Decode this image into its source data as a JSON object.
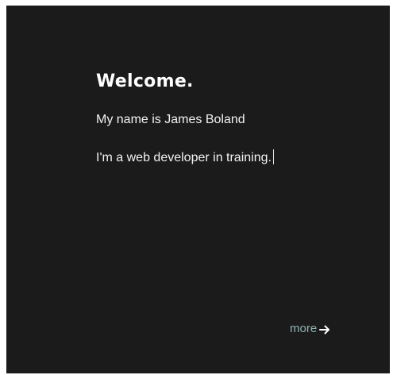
{
  "intro": {
    "heading": "Welcome.",
    "line1": "My name is James Boland",
    "line2": "I'm a web developer in training."
  },
  "more_link": {
    "label": "more",
    "icon": "arrow-right-icon",
    "label_color": "#8fb4b1"
  },
  "colors": {
    "background": "#1b1b1b",
    "text": "#ffffff"
  }
}
